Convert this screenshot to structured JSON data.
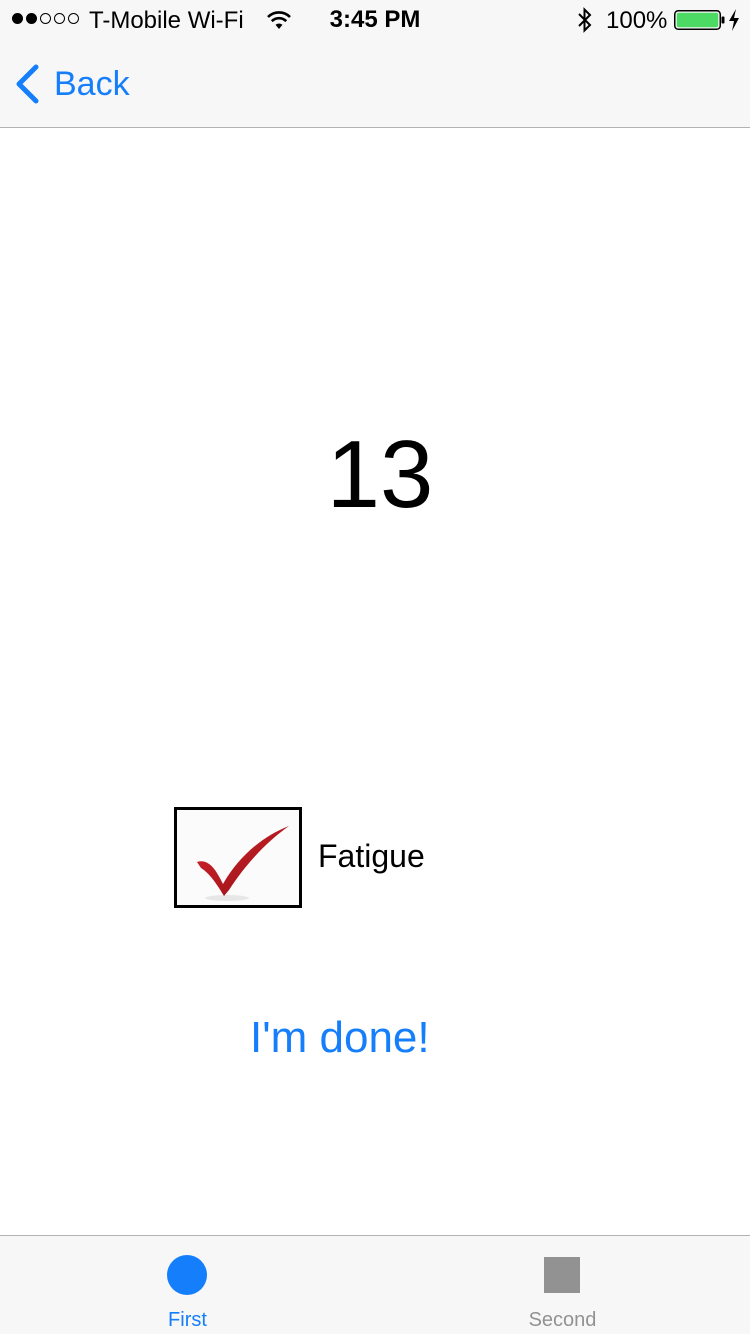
{
  "status_bar": {
    "carrier": "T-Mobile Wi-Fi",
    "time": "3:45 PM",
    "battery_percent": "100%",
    "signal_bars_filled": 2,
    "signal_bars_total": 5,
    "battery_level": 1.0,
    "battery_color": "#4cd964",
    "icons": [
      "wifi-icon",
      "bluetooth-icon",
      "battery-icon",
      "charging-icon"
    ]
  },
  "nav": {
    "back_label": "Back",
    "accent_color": "#157efb"
  },
  "main": {
    "count": "13",
    "option": {
      "label": "Fatigue",
      "checked": true,
      "check_color": "#b3141c"
    },
    "done_label": "I'm done!"
  },
  "tab_bar": {
    "tabs": [
      {
        "label": "First",
        "icon": "circle-icon",
        "selected": true
      },
      {
        "label": "Second",
        "icon": "square-icon",
        "selected": false
      }
    ]
  }
}
